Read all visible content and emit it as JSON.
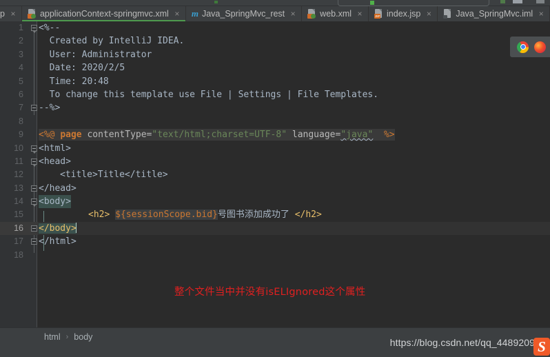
{
  "window": {
    "app": "IntelliJ IDEA",
    "theme_bg": "#2b2b2b",
    "tabbar_bg": "#3c3f41",
    "accent_active_tab": "#4e9a4e"
  },
  "tabs": [
    {
      "label": "p",
      "icon": "file-icon",
      "clipped": true,
      "active": false,
      "close": "×"
    },
    {
      "label": "applicationContext-springmvc.xml",
      "icon": "xml-file-icon",
      "clipped": false,
      "active": true,
      "close": "×"
    },
    {
      "label": "Java_SpringMvc_rest",
      "icon": "module-icon",
      "clipped": false,
      "active": false,
      "close": "×"
    },
    {
      "label": "web.xml",
      "icon": "xml-file-icon",
      "clipped": false,
      "active": false,
      "close": "×"
    },
    {
      "label": "index.jsp",
      "icon": "jsp-file-icon",
      "clipped": false,
      "active": false,
      "close": "×"
    },
    {
      "label": "Java_SpringMvc.iml",
      "icon": "iml-file-icon",
      "clipped": false,
      "active": false,
      "close": "×"
    }
  ],
  "editor": {
    "line_numbers": [
      "1",
      "2",
      "3",
      "4",
      "5",
      "6",
      "7",
      "8",
      "9",
      "10",
      "11",
      "12",
      "13",
      "14",
      "15",
      "16",
      "17",
      "18"
    ],
    "current_line": 16,
    "lines": {
      "l1": "<%--",
      "l2": "  Created by IntelliJ IDEA.",
      "l3": "  User: Administrator",
      "l4": "  Date: 2020/2/5",
      "l5": "  Time: 20:48",
      "l6": "  To change this template use File | Settings | File Templates.",
      "l7": "--%>",
      "l8": "",
      "l9_open": "<%@",
      "l9_kw": "page",
      "l9_attr1": "contentType=",
      "l9_val1": "\"text/html;charset=UTF-8\"",
      "l9_attr2": "language=",
      "l9_val2": "\"java\"",
      "l9_close": "%>",
      "l10": "<html>",
      "l11": "<head>",
      "l12": "<title>Title</title>",
      "l13": "</head>",
      "l14": "<body>",
      "l15_tag_open": "<h2>",
      "l15_el": "${sessionScope.bid}",
      "l15_text": "号图书添加成功了",
      "l15_tag_close": "</h2>",
      "l16": "</body>",
      "l17": "</html>",
      "l18": ""
    },
    "annotation": "整个文件当中并没有isELIgnored这个属性",
    "annotation_color": "#e02020",
    "colors": {
      "comment": "#629755",
      "tag": "#e8bf6a",
      "string": "#6a8759",
      "keyword": "#cc7832",
      "text": "#a9b7c6",
      "current_line_bg": "#323232",
      "brace_match_bg": "#3b514d"
    }
  },
  "browser_preview": {
    "buttons": [
      "chrome-icon",
      "firefox-icon"
    ]
  },
  "breadcrumb": {
    "items": [
      "html",
      "body"
    ],
    "separator": "›"
  },
  "watermark": {
    "url": "https://blog.csdn.net/qq_4489209",
    "logo_letter": "S",
    "logo_color": "#f05a28"
  }
}
